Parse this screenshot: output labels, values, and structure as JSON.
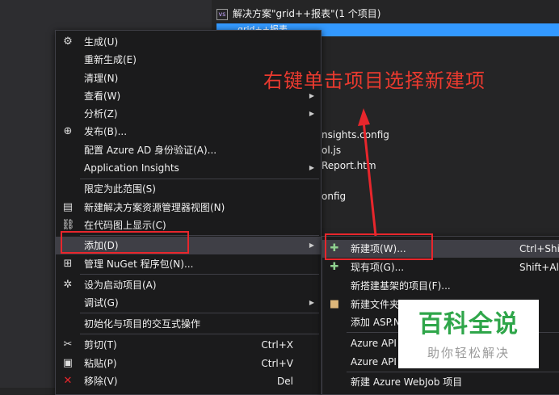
{
  "solution_explorer": {
    "header": "解决方案\"grid++报表\"(1 个项目)",
    "selected_item": "grid++报表",
    "fragments": [
      "nsights.config",
      "ol.js",
      "Report.htm",
      "onfig"
    ]
  },
  "context_menu": {
    "items": [
      {
        "label": "生成(U)",
        "icon": "build-icon"
      },
      {
        "label": "重新生成(E)"
      },
      {
        "label": "清理(N)"
      },
      {
        "label": "查看(W)",
        "arrow": "▶"
      },
      {
        "label": "分析(Z)",
        "arrow": "▶"
      },
      {
        "label": "发布(B)...",
        "icon": "globe-icon"
      },
      {
        "label": "配置 Azure AD 身份验证(A)..."
      },
      {
        "label": "Application Insights",
        "arrow": "▶"
      },
      {
        "label": "限定为此范围(S)"
      },
      {
        "label": "新建解决方案资源管理器视图(N)",
        "icon": "new-view-icon"
      },
      {
        "label": "在代码图上显示(C)",
        "icon": "code-map-icon"
      },
      {
        "label": "添加(D)",
        "arrow": "▶"
      },
      {
        "label": "管理 NuGet 程序包(N)...",
        "icon": "nuget-icon"
      },
      {
        "label": "设为启动项目(A)",
        "icon": "gear-icon"
      },
      {
        "label": "调试(G)",
        "arrow": "▶"
      },
      {
        "label": "初始化与项目的交互式操作"
      },
      {
        "label": "剪切(T)",
        "icon": "cut-icon",
        "shortcut": "Ctrl+X"
      },
      {
        "label": "粘贴(P)",
        "icon": "paste-icon",
        "shortcut": "Ctrl+V"
      },
      {
        "label": "移除(V)",
        "icon": "remove-icon",
        "shortcut": "Del"
      }
    ]
  },
  "submenu": {
    "items": [
      {
        "label": "新建项(W)...",
        "shortcut": "Ctrl+Shif",
        "icon": "new-item-icon"
      },
      {
        "label": "现有项(G)...",
        "shortcut": "Shift+Alt",
        "icon": "existing-item-icon"
      },
      {
        "label": "新搭建基架的项目(F)..."
      },
      {
        "label": "新建文件夹",
        "icon": "folder-icon"
      },
      {
        "label": "添加 ASP.N"
      },
      {
        "label": "Azure API"
      },
      {
        "label": "Azure API"
      },
      {
        "label": "新建 Azure WebJob 项目"
      }
    ]
  },
  "annotation": "右键单击项目选择新建项",
  "watermark": {
    "main": "百科全说",
    "sub": "助你轻松解决"
  },
  "colors": {
    "accent": "#3399ff",
    "annotation_red": "#e8262c",
    "watermark_green": "#2fa64a"
  }
}
